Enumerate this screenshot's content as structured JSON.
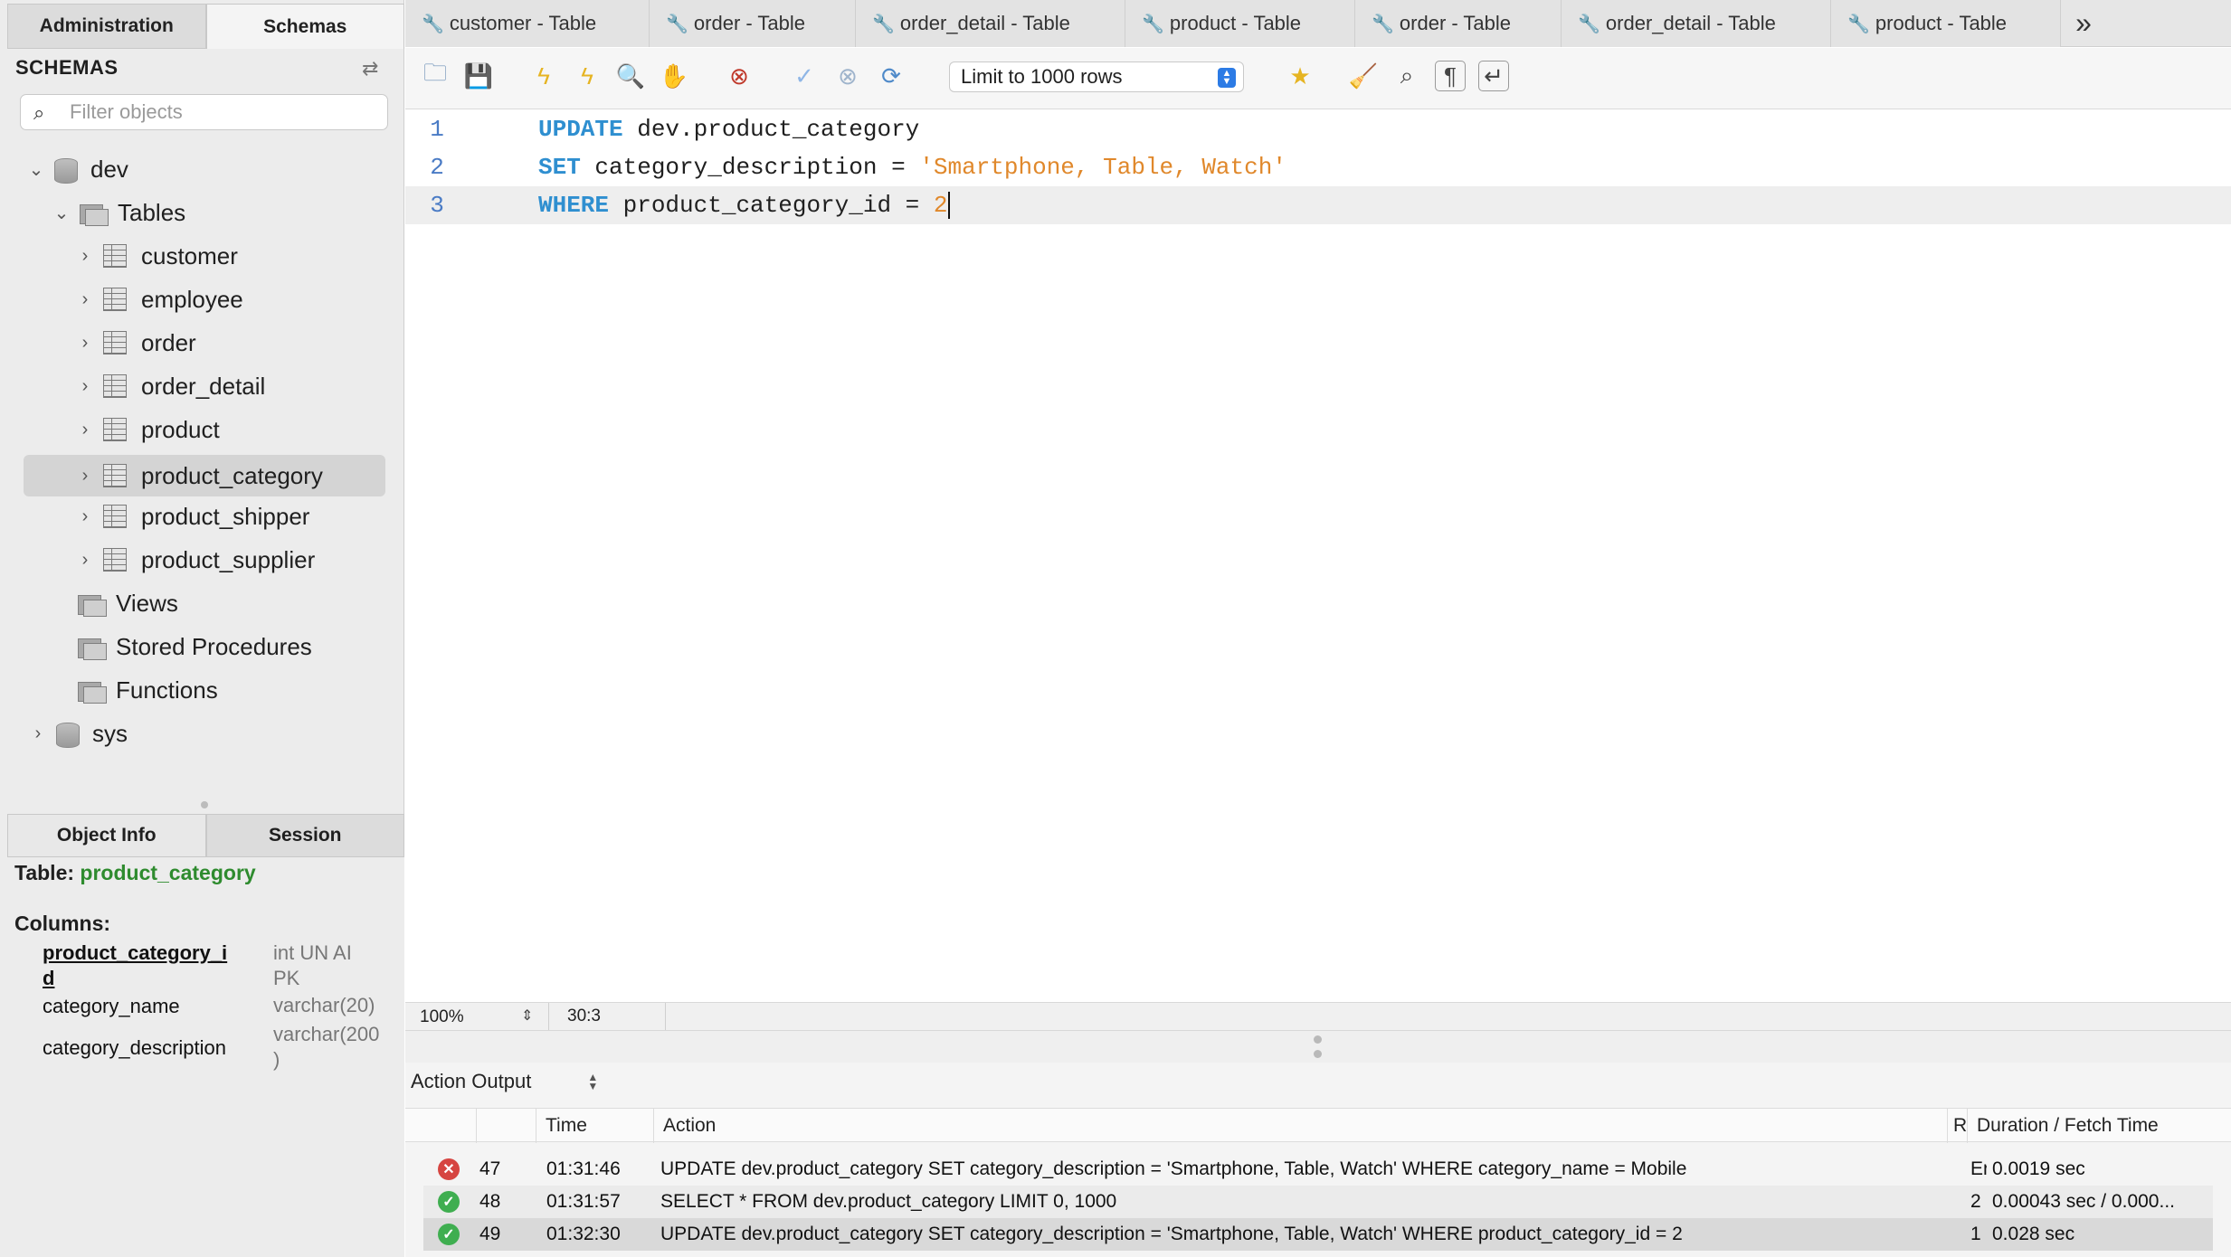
{
  "sidebar": {
    "tabs": [
      "Administration",
      "Schemas"
    ],
    "header": "SCHEMAS",
    "filter_placeholder": "Filter objects",
    "tree": {
      "db1": "dev",
      "tables_folder": "Tables",
      "tables": [
        "customer",
        "employee",
        "order",
        "order_detail",
        "product",
        "product_category",
        "product_shipper",
        "product_supplier"
      ],
      "views": "Views",
      "procedures": "Stored Procedures",
      "functions": "Functions",
      "db2": "sys"
    },
    "info_tabs": [
      "Object Info",
      "Session"
    ],
    "info": {
      "table_label": "Table:",
      "table_name": "product_category",
      "columns_label": "Columns:",
      "columns": [
        {
          "name": "product_category_i",
          "name2": "d",
          "type": "int UN AI",
          "type2": "PK"
        },
        {
          "name": "category_name",
          "type": "varchar(20)"
        },
        {
          "name": "category_description",
          "type": "varchar(200",
          "type2": ")"
        }
      ]
    }
  },
  "editor_tabs": [
    "customer - Table",
    "order - Table",
    "order_detail - Table",
    "product - Table",
    "order - Table",
    "order_detail - Table",
    "product - Table"
  ],
  "toolbar": {
    "limit": "Limit to 1000 rows"
  },
  "editor": {
    "lines": [
      {
        "num": "1",
        "kw": "UPDATE",
        "rest": " dev.product_category"
      },
      {
        "num": "2",
        "kw": "SET",
        "rest": " category_description = ",
        "str": "'Smartphone, Table, Watch'"
      },
      {
        "num": "3",
        "kw": "WHERE",
        "rest": " product_category_id = ",
        "num_val": "2"
      }
    ]
  },
  "statusbar": {
    "zoom": "100%",
    "position": "30:3"
  },
  "output": {
    "selector": "Action Output",
    "headers": {
      "time": "Time",
      "action": "Action",
      "response": "R",
      "duration": "Duration / Fetch Time"
    },
    "rows": [
      {
        "status": "error",
        "num": "47",
        "time": "01:31:46",
        "action": "UPDATE dev.product_category SET category_description = 'Smartphone, Table, Watch' WHERE category_name = Mobile",
        "response": "Er",
        "duration": "0.0019 sec"
      },
      {
        "status": "ok",
        "num": "48",
        "time": "01:31:57",
        "action": "SELECT * FROM dev.product_category LIMIT 0, 1000",
        "response": "2",
        "duration": "0.00043 sec / 0.000..."
      },
      {
        "status": "ok",
        "num": "49",
        "time": "01:32:30",
        "action": "UPDATE dev.product_category SET category_description = 'Smartphone, Table, Watch' WHERE product_category_id = 2",
        "response": "1",
        "duration": "0.028 sec"
      }
    ]
  }
}
